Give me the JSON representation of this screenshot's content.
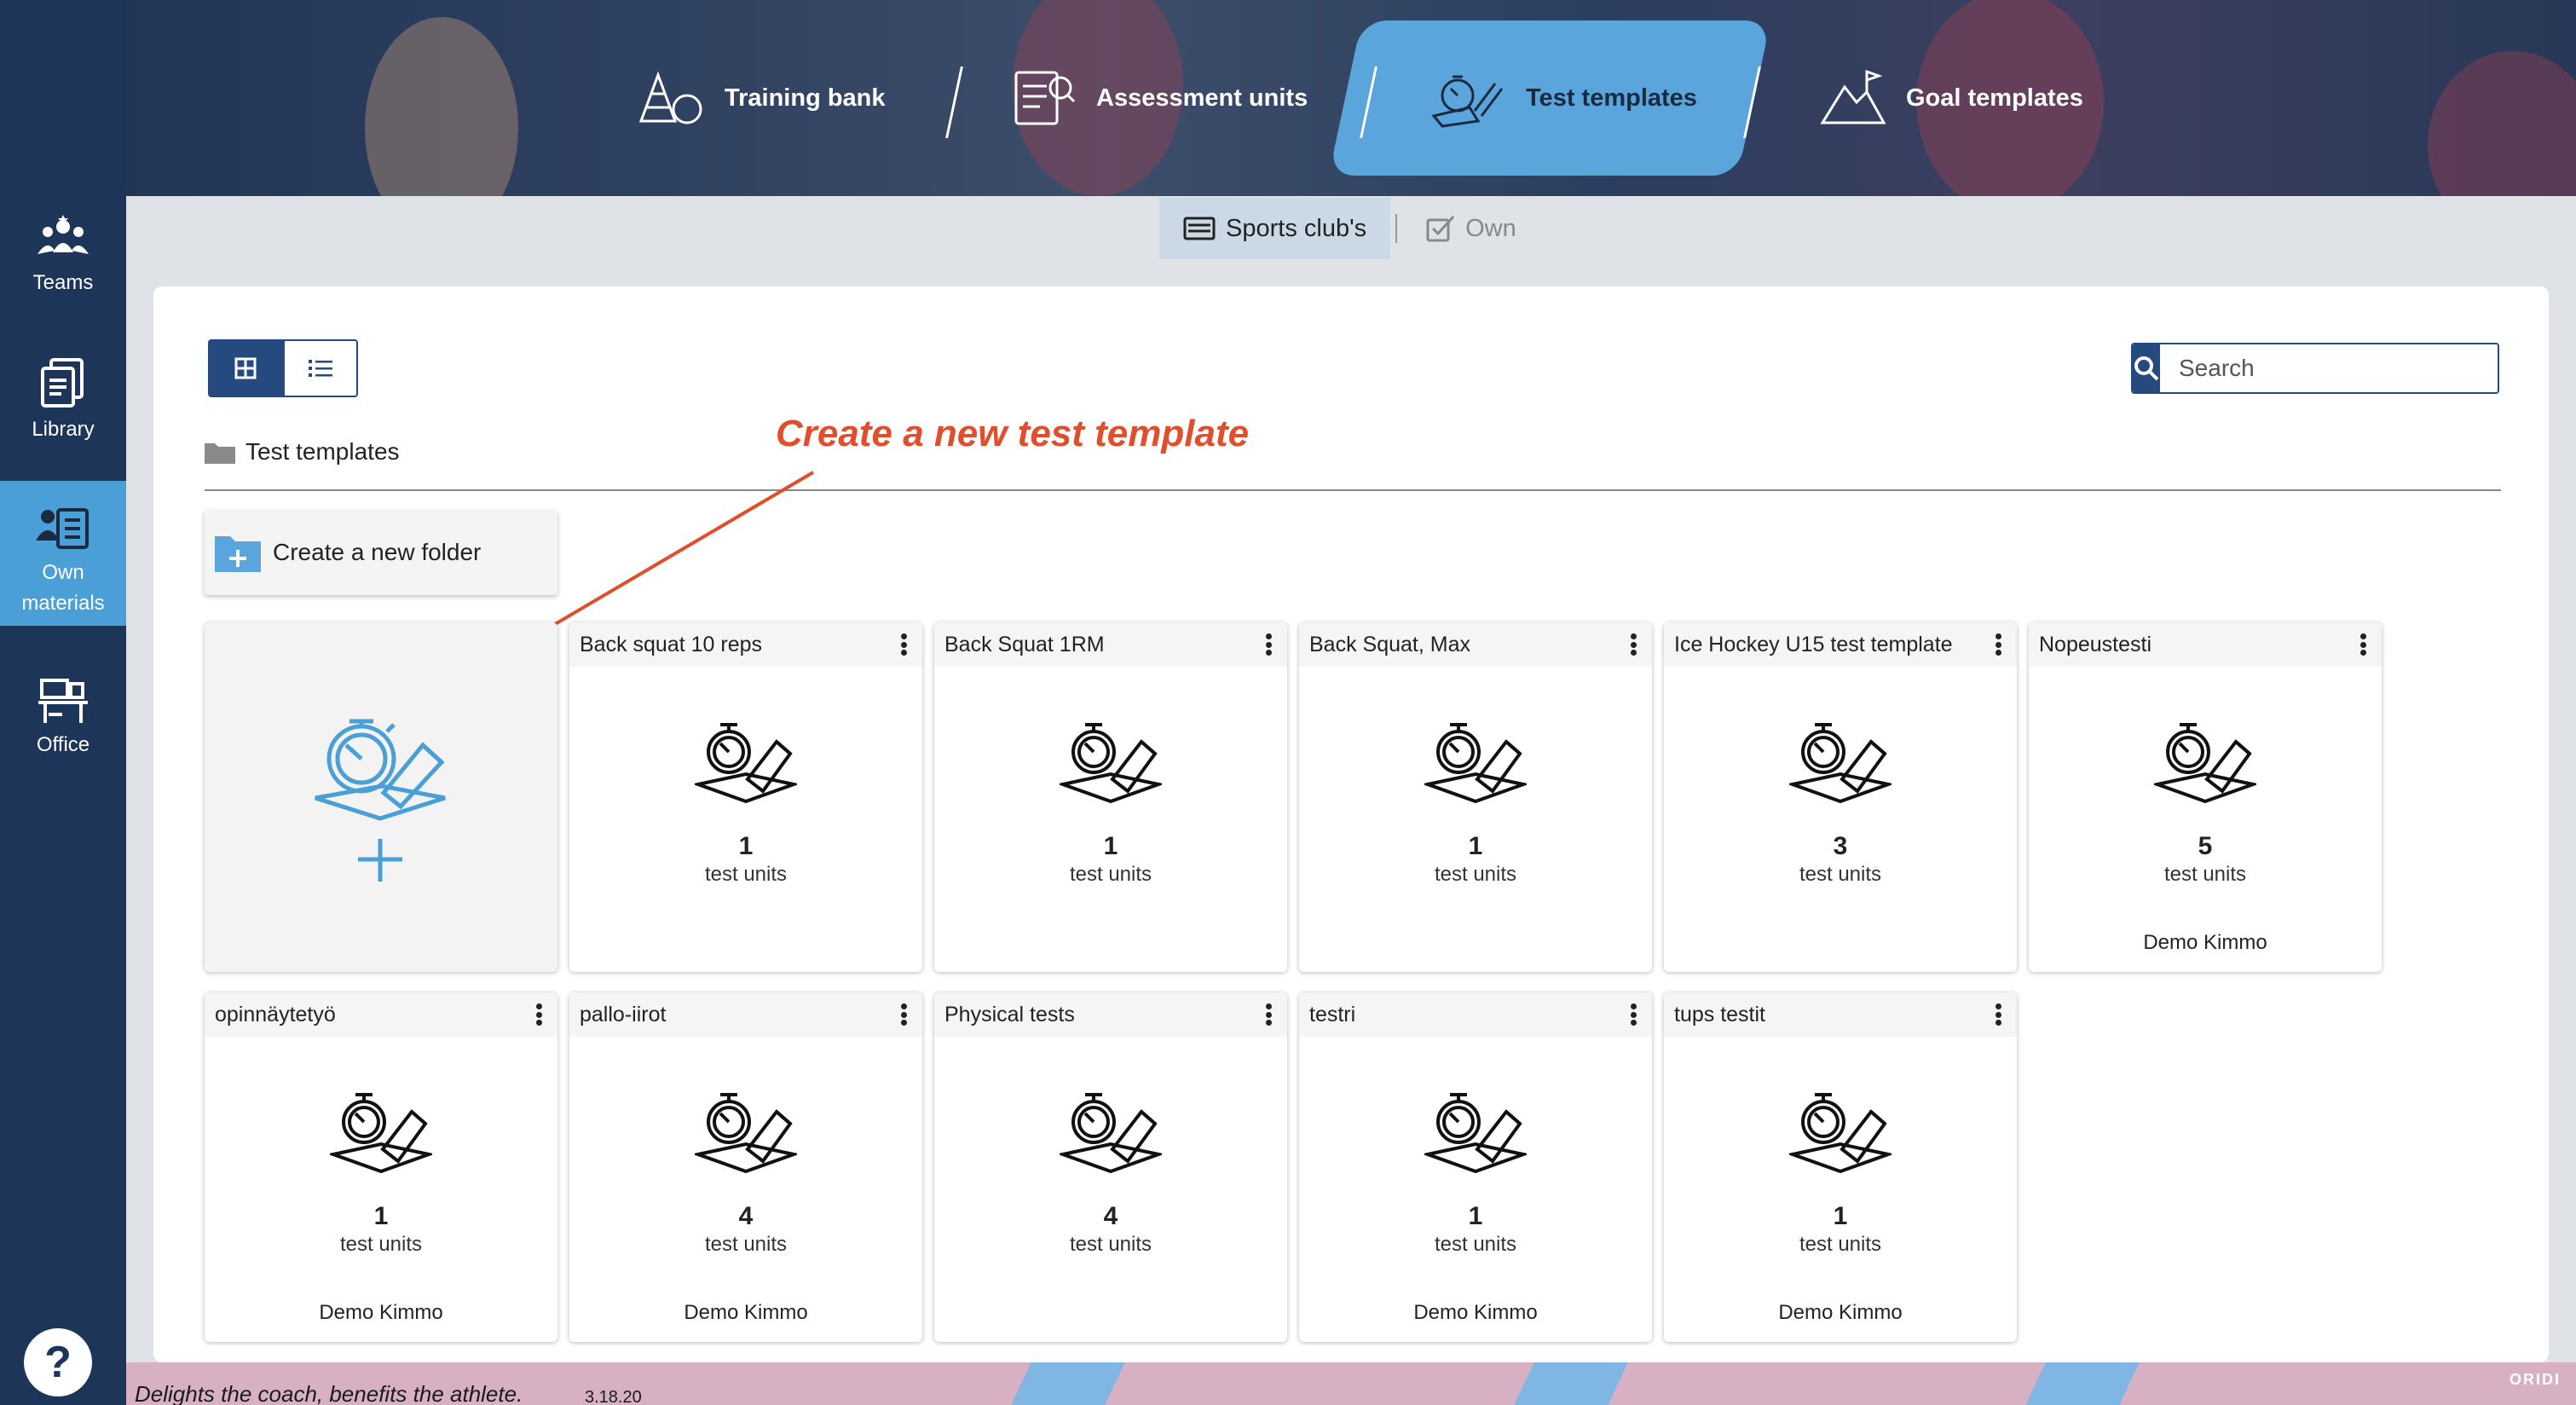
{
  "sidebar": {
    "items": [
      {
        "label": "Teams",
        "icon": "teams-icon"
      },
      {
        "label": "Library",
        "icon": "library-icon"
      },
      {
        "label": "Own",
        "label2": "materials",
        "icon": "own-materials-icon",
        "active": true
      },
      {
        "label": "Office",
        "icon": "office-icon"
      }
    ],
    "help": "?"
  },
  "header": {
    "tabs": [
      {
        "label": "Training bank",
        "icon": "training-bank-icon"
      },
      {
        "label": "Assessment units",
        "icon": "assessment-units-icon"
      },
      {
        "label": "Test templates",
        "icon": "stopwatch-pencil-icon",
        "active": true
      },
      {
        "label": "Goal templates",
        "icon": "mountain-flag-icon"
      }
    ]
  },
  "subtabs": {
    "club": "Sports club's",
    "own": "Own"
  },
  "toolbar": {
    "search_placeholder": "Search"
  },
  "breadcrumb": {
    "label": "Test templates"
  },
  "annotation": {
    "text": "Create a new test template"
  },
  "new_folder": {
    "label": "Create a new folder"
  },
  "cards": [
    {
      "title": "Back squat 10 reps",
      "count": "1",
      "unit": "test units",
      "owner": ""
    },
    {
      "title": "Back Squat 1RM",
      "count": "1",
      "unit": "test units",
      "owner": ""
    },
    {
      "title": "Back Squat, Max",
      "count": "1",
      "unit": "test units",
      "owner": ""
    },
    {
      "title": "Ice Hockey U15 test template",
      "count": "3",
      "unit": "test units",
      "owner": ""
    },
    {
      "title": "Nopeustesti",
      "count": "5",
      "unit": "test units",
      "owner": "Demo Kimmo"
    },
    {
      "title": "opinnäytetyö",
      "count": "1",
      "unit": "test units",
      "owner": "Demo Kimmo"
    },
    {
      "title": "pallo-iirot",
      "count": "4",
      "unit": "test units",
      "owner": "Demo Kimmo"
    },
    {
      "title": "Physical tests",
      "count": "4",
      "unit": "test units",
      "owner": ""
    },
    {
      "title": "testri",
      "count": "1",
      "unit": "test units",
      "owner": "Demo Kimmo"
    },
    {
      "title": "tups testit",
      "count": "1",
      "unit": "test units",
      "owner": "Demo Kimmo"
    }
  ],
  "footer": {
    "tagline": "Delights the coach, benefits the athlete.",
    "version": "3.18.20",
    "brand": "ORIDI"
  },
  "colors": {
    "sidebar": "#1c3559",
    "accent": "#4a9fd6",
    "primary_button": "#254a80",
    "annotation": "#e04e2c"
  }
}
